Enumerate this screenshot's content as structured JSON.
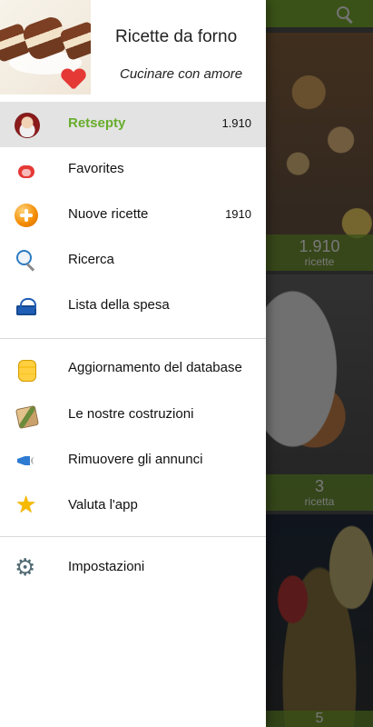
{
  "drawer": {
    "title": "Ricette da forno",
    "subtitle": "Cucinare con amore",
    "items": [
      {
        "label": "Retsepty",
        "count": "1.910",
        "icon": "chef-avatar-icon"
      },
      {
        "label": "Favorites",
        "count": "",
        "icon": "heart-icon"
      },
      {
        "label": "Nuove ricette",
        "count": "1910",
        "icon": "plus-circle-icon"
      },
      {
        "label": "Ricerca",
        "count": "",
        "icon": "search-icon"
      },
      {
        "label": "Lista della spesa",
        "count": "",
        "icon": "shopping-basket-icon"
      },
      {
        "label": "Aggiornamento del database",
        "count": "",
        "icon": "database-icon"
      },
      {
        "label": "Le nostre costruzioni",
        "count": "",
        "icon": "builds-icon"
      },
      {
        "label": "Rimuovere gli annunci",
        "count": "",
        "icon": "megaphone-icon"
      },
      {
        "label": "Valuta l'app",
        "count": "",
        "icon": "star-icon"
      },
      {
        "label": "Impostazioni",
        "count": "",
        "icon": "gear-icon"
      }
    ],
    "active_color": "#67ad2c"
  },
  "background": {
    "cards": [
      {
        "count": "1.910",
        "label": "ricette"
      },
      {
        "count": "3",
        "label": "ricetta"
      },
      {
        "count": "5",
        "label": ""
      }
    ]
  }
}
